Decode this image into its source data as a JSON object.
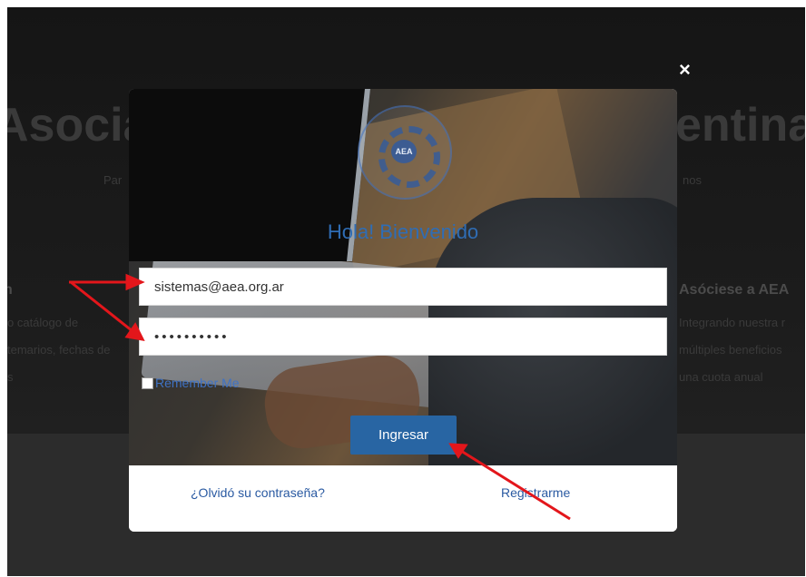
{
  "background": {
    "title_left": "Asocia",
    "title_right": "entina",
    "subtitle_left": "Par",
    "subtitle_right": "nos",
    "left_column": {
      "heading": "n",
      "lines": [
        "o catálogo de",
        "temarios, fechas de",
        "s"
      ]
    },
    "right_column": {
      "heading": "Asóciese a AEA",
      "lines": [
        "Integrando nuestra r",
        "múltiples beneficios",
        "una cuota anual"
      ]
    }
  },
  "modal": {
    "close_label": "×",
    "logo_text": "AEA",
    "welcome": "Hola! Bienvenido",
    "email_value": "sistemas@aea.org.ar",
    "password_value": "••••••••••",
    "remember_label": "Remember Me",
    "submit_label": "Ingresar",
    "forgot_label": "¿Olvidó su contraseña?",
    "register_label": "Registrarme"
  },
  "colors": {
    "accent": "#2865a3",
    "annotation_arrow": "#e3161b"
  }
}
